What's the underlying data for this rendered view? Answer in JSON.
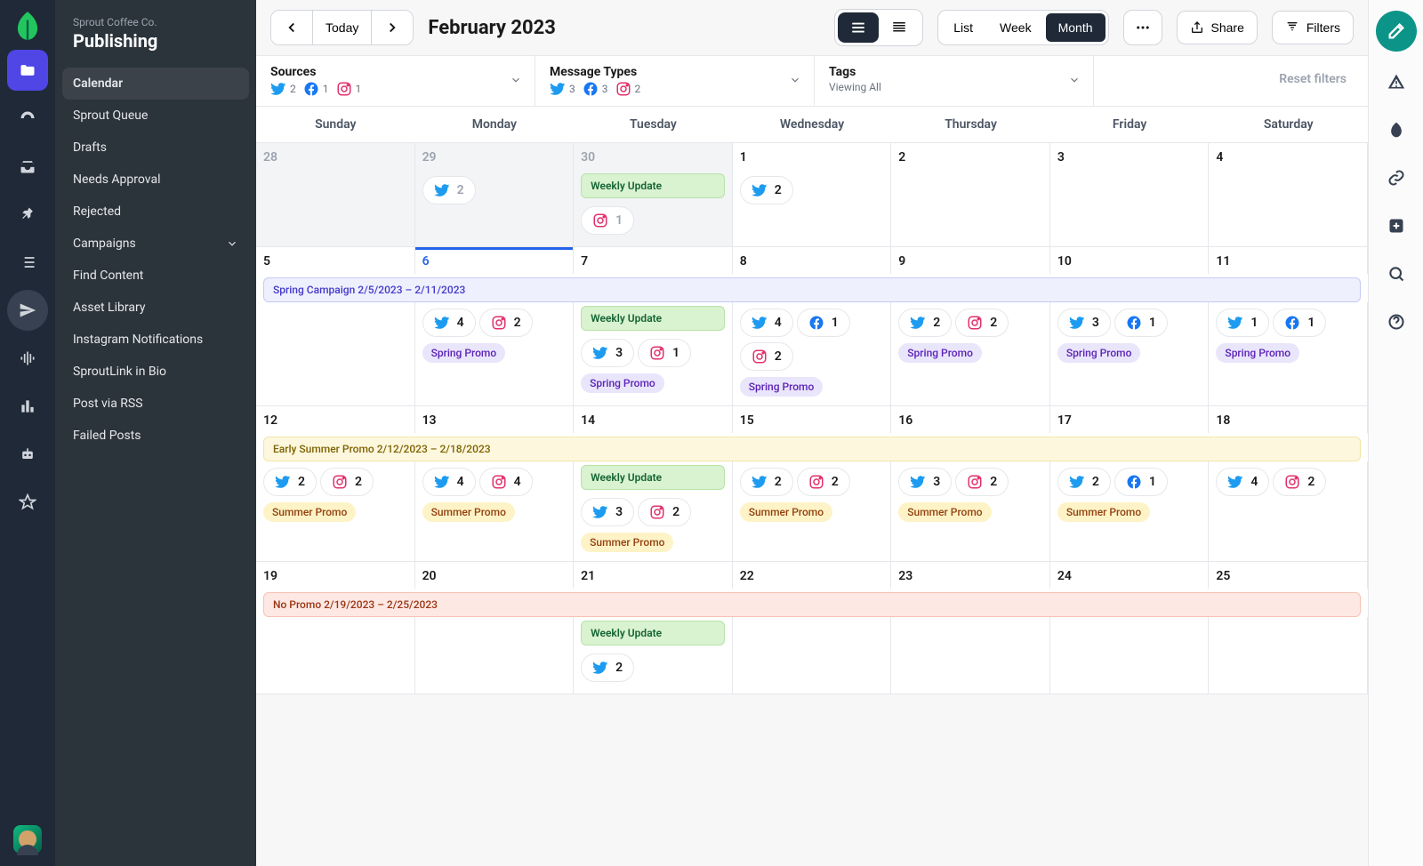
{
  "org": {
    "name": "Sprout Coffee Co.",
    "section": "Publishing"
  },
  "nav": {
    "items": [
      "Calendar",
      "Sprout Queue",
      "Drafts",
      "Needs Approval",
      "Rejected",
      "Campaigns",
      "Find Content",
      "Asset Library",
      "Instagram Notifications",
      "SproutLink in Bio",
      "Post via RSS",
      "Failed Posts"
    ],
    "active": 0,
    "expandable": 5
  },
  "toolbar": {
    "today": "Today",
    "title": "February 2023",
    "views": [
      "List",
      "Week",
      "Month"
    ],
    "activeView": 2,
    "share": "Share",
    "filters": "Filters"
  },
  "filters": {
    "sources": {
      "label": "Sources",
      "counts": [
        {
          "net": "tw",
          "n": "2"
        },
        {
          "net": "fb",
          "n": "1"
        },
        {
          "net": "ig",
          "n": "1"
        }
      ]
    },
    "types": {
      "label": "Message Types",
      "counts": [
        {
          "net": "tw",
          "n": "3"
        },
        {
          "net": "fb",
          "n": "3"
        },
        {
          "net": "ig",
          "n": "2"
        }
      ]
    },
    "tags": {
      "label": "Tags",
      "sub": "Viewing All"
    },
    "reset": "Reset filters"
  },
  "dow": [
    "Sunday",
    "Monday",
    "Tuesday",
    "Wednesday",
    "Thursday",
    "Friday",
    "Saturday"
  ],
  "weekly": "Weekly Update",
  "weeks": [
    {
      "days": [
        {
          "n": "28",
          "other": true
        },
        {
          "n": "29",
          "other": true,
          "pills": [
            {
              "net": "tw",
              "n": "2"
            }
          ]
        },
        {
          "n": "30",
          "other": true,
          "weekly": true,
          "pills": [
            {
              "net": "ig",
              "n": "1"
            }
          ]
        },
        {
          "n": "1",
          "pills": [
            {
              "net": "tw",
              "n": "2"
            }
          ]
        },
        {
          "n": "2"
        },
        {
          "n": "3"
        },
        {
          "n": "4"
        }
      ]
    },
    {
      "banner": {
        "style": "purple",
        "text": "Spring Campaign 2/5/2023 – 2/11/2023"
      },
      "days": [
        {
          "n": "5"
        },
        {
          "n": "6",
          "today": true,
          "pills": [
            {
              "net": "tw",
              "n": "4"
            },
            {
              "net": "ig",
              "n": "2"
            }
          ],
          "tag": {
            "style": "purple",
            "text": "Spring Promo"
          }
        },
        {
          "n": "7",
          "weekly": true,
          "pills": [
            {
              "net": "tw",
              "n": "3"
            },
            {
              "net": "ig",
              "n": "1"
            }
          ],
          "tag": {
            "style": "purple",
            "text": "Spring Promo"
          }
        },
        {
          "n": "8",
          "pills": [
            {
              "net": "tw",
              "n": "4"
            },
            {
              "net": "fb",
              "n": "1"
            },
            {
              "net": "ig",
              "n": "2"
            }
          ],
          "tag": {
            "style": "purple",
            "text": "Spring Promo"
          }
        },
        {
          "n": "9",
          "pills": [
            {
              "net": "tw",
              "n": "2"
            },
            {
              "net": "ig",
              "n": "2"
            }
          ],
          "tag": {
            "style": "purple",
            "text": "Spring Promo"
          }
        },
        {
          "n": "10",
          "pills": [
            {
              "net": "tw",
              "n": "3"
            },
            {
              "net": "fb",
              "n": "1"
            }
          ],
          "tag": {
            "style": "purple",
            "text": "Spring Promo"
          }
        },
        {
          "n": "11",
          "pills": [
            {
              "net": "tw",
              "n": "1"
            },
            {
              "net": "fb",
              "n": "1"
            }
          ],
          "tag": {
            "style": "purple",
            "text": "Spring Promo"
          }
        }
      ]
    },
    {
      "banner": {
        "style": "yellow",
        "text": "Early Summer Promo 2/12/2023 – 2/18/2023"
      },
      "days": [
        {
          "n": "12",
          "pills": [
            {
              "net": "tw",
              "n": "2"
            },
            {
              "net": "ig",
              "n": "2"
            }
          ],
          "tag": {
            "style": "yellow",
            "text": "Summer Promo"
          }
        },
        {
          "n": "13",
          "pills": [
            {
              "net": "tw",
              "n": "4"
            },
            {
              "net": "ig",
              "n": "4"
            }
          ],
          "tag": {
            "style": "yellow",
            "text": "Summer Promo"
          }
        },
        {
          "n": "14",
          "weekly": true,
          "pills": [
            {
              "net": "tw",
              "n": "3"
            },
            {
              "net": "ig",
              "n": "2"
            }
          ],
          "tag": {
            "style": "yellow",
            "text": "Summer Promo"
          }
        },
        {
          "n": "15",
          "pills": [
            {
              "net": "tw",
              "n": "2"
            },
            {
              "net": "ig",
              "n": "2"
            }
          ],
          "tag": {
            "style": "yellow",
            "text": "Summer Promo"
          }
        },
        {
          "n": "16",
          "pills": [
            {
              "net": "tw",
              "n": "3"
            },
            {
              "net": "ig",
              "n": "2"
            }
          ],
          "tag": {
            "style": "yellow",
            "text": "Summer Promo"
          }
        },
        {
          "n": "17",
          "pills": [
            {
              "net": "tw",
              "n": "2"
            },
            {
              "net": "fb",
              "n": "1"
            }
          ],
          "tag": {
            "style": "yellow",
            "text": "Summer Promo"
          }
        },
        {
          "n": "18",
          "pills": [
            {
              "net": "tw",
              "n": "4"
            },
            {
              "net": "ig",
              "n": "2"
            }
          ]
        }
      ]
    },
    {
      "banner": {
        "style": "red",
        "text": "No Promo 2/19/2023 – 2/25/2023"
      },
      "days": [
        {
          "n": "19"
        },
        {
          "n": "20"
        },
        {
          "n": "21",
          "weekly": true,
          "pills": [
            {
              "net": "tw",
              "n": "2"
            }
          ]
        },
        {
          "n": "22"
        },
        {
          "n": "23"
        },
        {
          "n": "24"
        },
        {
          "n": "25"
        }
      ]
    }
  ]
}
